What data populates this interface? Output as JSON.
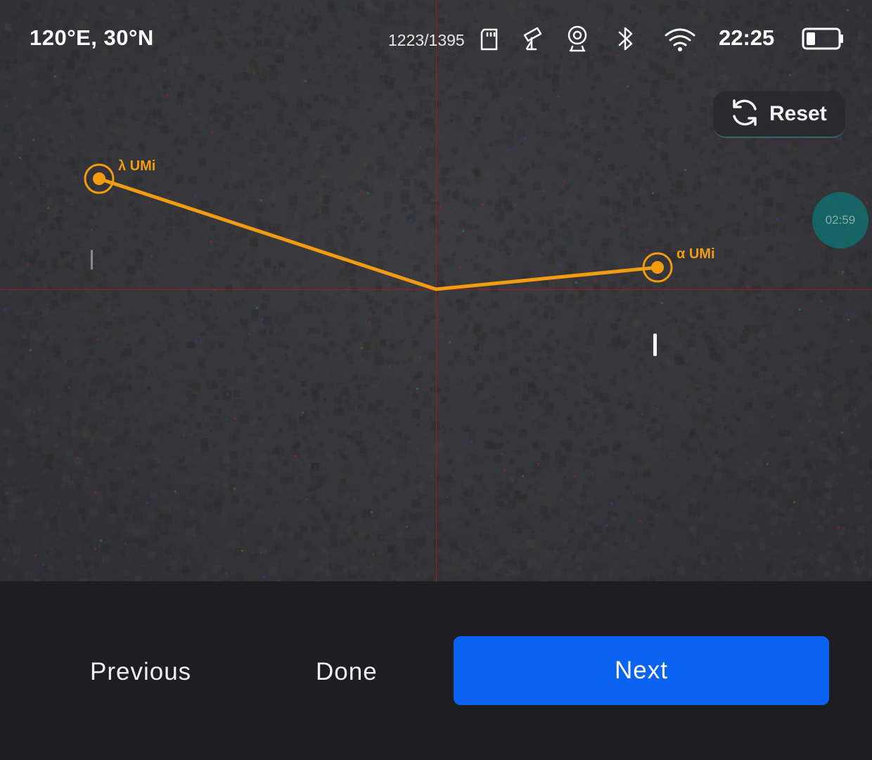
{
  "status_bar": {
    "coordinates": "120°E, 30°N",
    "storage": "1223/1395",
    "time": "22:25",
    "icons": [
      "sd-card-icon",
      "telescope-icon",
      "camera-icon",
      "bluetooth-icon",
      "wifi-icon",
      "battery-icon"
    ]
  },
  "reset_button": {
    "label": "Reset",
    "icon": "refresh-icon"
  },
  "timer": {
    "text": "02:59"
  },
  "stars": [
    {
      "label": "λ UMi"
    },
    {
      "label": "α UMi"
    }
  ],
  "bottom_bar": {
    "previous_label": "Previous",
    "done_label": "Done",
    "next_label": "Next"
  },
  "colors": {
    "accent_orange": "#f29d10",
    "crosshair_red": "#b3121a",
    "next_button_blue": "#0a63f0",
    "timer_teal": "#008c8c"
  }
}
